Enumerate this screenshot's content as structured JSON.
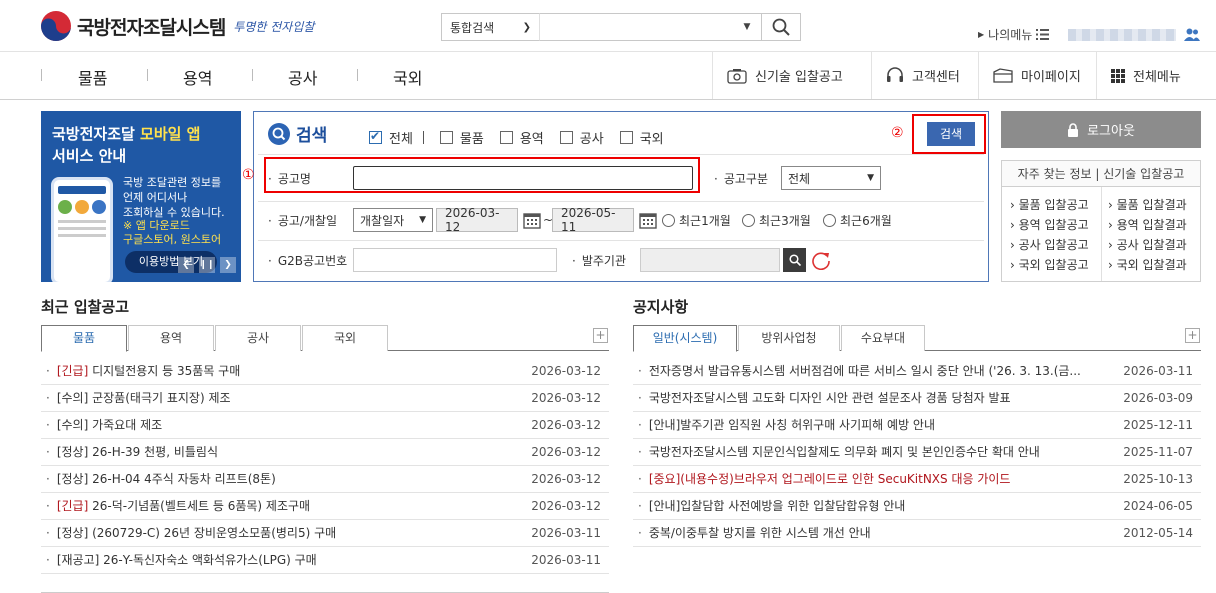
{
  "header": {
    "logo_text": "국방전자조달시스템",
    "slogan": "투명한 전자입찰",
    "search_scope": "통합검색",
    "my_menu": "나의메뉴"
  },
  "nav": {
    "items": [
      "물품",
      "용역",
      "공사",
      "국외"
    ],
    "right": [
      "신기술 입찰공고",
      "고객센터",
      "마이페이지",
      "전체메뉴"
    ]
  },
  "banner": {
    "title_prefix": "국방전자조달",
    "title_highlight": "모바일 앱",
    "title2": "서비스 안내",
    "desc": [
      "국방 조달관련 정보를",
      "언제 어디서나",
      "조회하실 수 있습니다."
    ],
    "store": [
      "※ 앱 다운로드",
      "구글스토어, 원스토어"
    ],
    "button": "이용방법 보기"
  },
  "search_panel": {
    "title": "검색",
    "checks": [
      {
        "label": "전체",
        "checked": true
      },
      {
        "label": "물품",
        "checked": false
      },
      {
        "label": "용역",
        "checked": false
      },
      {
        "label": "공사",
        "checked": false
      },
      {
        "label": "국외",
        "checked": false
      }
    ],
    "search_btn": "검색",
    "mark1": "①",
    "mark2": "②",
    "field_title": "공고명",
    "field_type": "공고구분",
    "type_value": "전체",
    "field_date": "공고/개찰일",
    "date_kind": "개찰일자",
    "date_from": "2026-03-12",
    "date_sep": "~",
    "date_to": "2026-05-11",
    "periods": [
      "최근1개월",
      "최근3개월",
      "최근6개월"
    ],
    "field_g2b": "G2B공고번호",
    "field_org": "발주기관"
  },
  "side": {
    "logout": "로그아웃",
    "quick_head": "자주 찾는 정보 | 신기술 입찰공고",
    "left": [
      "물품 입찰공고",
      "용역 입찰공고",
      "공사 입찰공고",
      "국외 입찰공고"
    ],
    "right": [
      "물품 입찰결과",
      "용역 입찰결과",
      "공사 입찰결과",
      "국외 입찰결과"
    ]
  },
  "bids": {
    "title": "최근 입찰공고",
    "tabs": [
      "물품",
      "용역",
      "공사",
      "국외"
    ],
    "plus": "+",
    "rows": [
      {
        "tag": "[긴급]",
        "text": " 디지털전용지 등 35품목 구매",
        "date": "2026-03-12",
        "urgent": true
      },
      {
        "tag": "[수의]",
        "text": " 군장품(태극기 표지장) 제조",
        "date": "2026-03-12",
        "urgent": false
      },
      {
        "tag": "[수의]",
        "text": " 가죽요대 제조",
        "date": "2026-03-12",
        "urgent": false
      },
      {
        "tag": "[정상]",
        "text": " 26-H-39 천평, 비틀림식",
        "date": "2026-03-12",
        "urgent": false
      },
      {
        "tag": "[정상]",
        "text": " 26-H-04 4주식 자동차 리프트(8톤)",
        "date": "2026-03-12",
        "urgent": false
      },
      {
        "tag": "[긴급]",
        "text": " 26-덕-기념품(벨트세트 등 6품목) 제조구매",
        "date": "2026-03-12",
        "urgent": true
      },
      {
        "tag": "[정상]",
        "text": " (260729-C) 26년 장비운영소모품(병리5) 구매",
        "date": "2026-03-11",
        "urgent": false
      },
      {
        "tag": "[재공고]",
        "text": " 26-Y-독신자숙소 액화석유가스(LPG) 구매",
        "date": "2026-03-11",
        "urgent": false
      }
    ]
  },
  "notices": {
    "title": "공지사항",
    "tabs": [
      "일반(시스템)",
      "방위사업청",
      "수요부대"
    ],
    "plus": "+",
    "rows": [
      {
        "text": "전자증명서 발급유통시스템 서버점검에 따른 서비스 일시 중단 안내 ('26. 3. 13.(금...",
        "date": "2026-03-11",
        "red": false
      },
      {
        "text": "국방전자조달시스템 고도화 디자인 시안 관련 설문조사 경품 당첨자 발표",
        "date": "2026-03-09",
        "red": false
      },
      {
        "text": "[안내]발주기관 임직원 사칭 허위구매 사기피해 예방 안내",
        "date": "2025-12-11",
        "red": false
      },
      {
        "text": "국방전자조달시스템 지문인식입찰제도 의무화 폐지 및 본인인증수단 확대 안내",
        "date": "2025-11-07",
        "red": false
      },
      {
        "text": "[중요](내용수정)브라우저 업그레이드로 인한 SecuKitNXS 대응 가이드",
        "date": "2025-10-13",
        "red": true
      },
      {
        "text": "[안내]입찰담합 사전예방을 위한 입찰담합유형 안내",
        "date": "2024-06-05",
        "red": false
      },
      {
        "text": "중복/이중투찰 방지를 위한 시스템 개선 안내",
        "date": "2012-05-14",
        "red": false
      }
    ]
  }
}
